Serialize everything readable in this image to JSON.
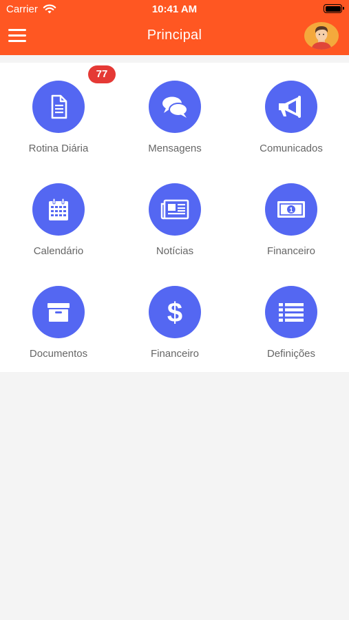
{
  "status_bar": {
    "carrier": "Carrier",
    "time": "10:41 AM"
  },
  "header": {
    "title": "Principal",
    "background_color": "#ff5722",
    "menu_icon": "hamburger-icon",
    "avatar_icon": "user-avatar"
  },
  "grid": {
    "accent_color": "#5467f2",
    "items": [
      {
        "label": "Rotina Diária",
        "icon": "document-icon",
        "badge": "77"
      },
      {
        "label": "Mensagens",
        "icon": "chat-bubbles-icon"
      },
      {
        "label": "Comunicados",
        "icon": "megaphone-icon"
      },
      {
        "label": "Calendário",
        "icon": "calendar-icon"
      },
      {
        "label": "Notícias",
        "icon": "newspaper-icon"
      },
      {
        "label": "Financeiro",
        "icon": "money-bill-icon"
      },
      {
        "label": "Documentos",
        "icon": "archive-box-icon"
      },
      {
        "label": "Financeiro",
        "icon": "dollar-icon"
      },
      {
        "label": "Definições",
        "icon": "list-icon"
      }
    ]
  }
}
